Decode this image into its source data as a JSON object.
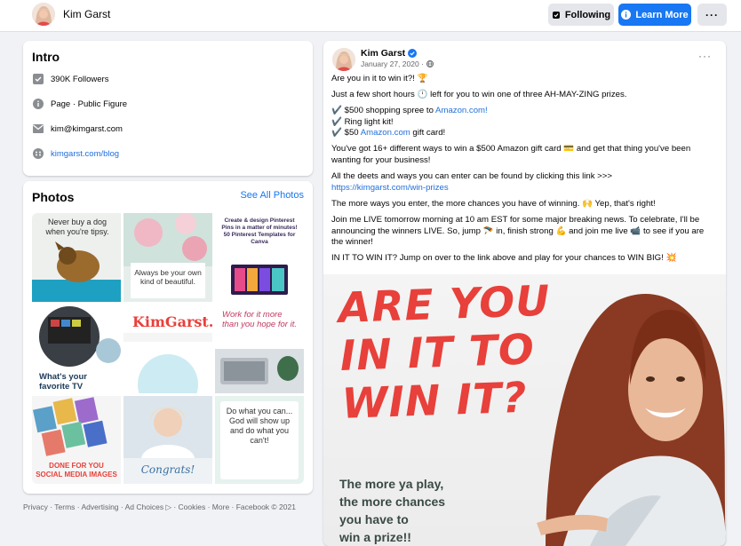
{
  "header": {
    "name": "Kim Garst",
    "following_label": "Following",
    "learn_more_label": "Learn More",
    "more_label": "···"
  },
  "intro": {
    "title": "Intro",
    "followers": "390K Followers",
    "category": "Page · Public Figure",
    "email": "kim@kimgarst.com",
    "website": "kimgarst.com/blog"
  },
  "photos": {
    "title": "Photos",
    "see_all_label": "See All Photos",
    "tiles": [
      "Never buy a dog when you're tipsy.",
      "Always be your own kind of beautiful.",
      "Create & design Pinterest Pins in a matter of minutes! 50 Pinterest Templates for Canva",
      "What's your favorite TV",
      "KimGarst.",
      "Work for it more than you hope for it.",
      "DONE FOR YOU SOCIAL MEDIA IMAGES",
      "Congrats!",
      "Do what you can... God will show up and do what you can't!"
    ]
  },
  "footer": "Privacy · Terms · Advertising · Ad Choices ▷ · Cookies · More · Facebook © 2021",
  "post": {
    "author": "Kim Garst",
    "date": "January 27, 2020 ·",
    "menu": "···",
    "p1": "Are you in it to win it?! 🏆",
    "p2a": "Just a few short hours ",
    "p2b": " left for you to win one of three AH-MAY-ZING prizes.",
    "item1_text": "$500 shopping spree to ",
    "item1_link": "Amazon.com!",
    "item2_text": "Ring light kit!",
    "item3_text": "$50 ",
    "item3_link": "Amazon.com",
    "item3_suffix": " gift card!",
    "p4": "You've got 16+ different ways to win a $500 Amazon gift card 💳 and get that thing you've been wanting for your business!",
    "p5": "All the deets and ways you can enter can be found by clicking this link >>>",
    "p5_link": "https://kimgarst.com/win-prizes",
    "p6": "The more ways you enter, the more chances you have of winning. 🙌 Yep, that's right!",
    "p7": "Join me LIVE tomorrow morning at 10 am EST for some major breaking news. To celebrate, I'll be announcing the winners LIVE. So, jump 🪂 in, finish strong 💪 and join me live 📹 to see if you are the winner!",
    "p8": "IN IT TO WIN IT? Jump on over to the link above and play for your chances to WIN BIG! 💥",
    "hero_line1": "ARE YOU",
    "hero_line2": "IN IT TO",
    "hero_line3": "WIN IT?",
    "hero_sub1": "The more ya play,",
    "hero_sub2": "the more chances",
    "hero_sub3": "you have to",
    "hero_sub4": "win a prize!!"
  },
  "colors": {
    "accent": "#1877f2",
    "link": "#216fdb",
    "headline_red": "#e8403a"
  }
}
